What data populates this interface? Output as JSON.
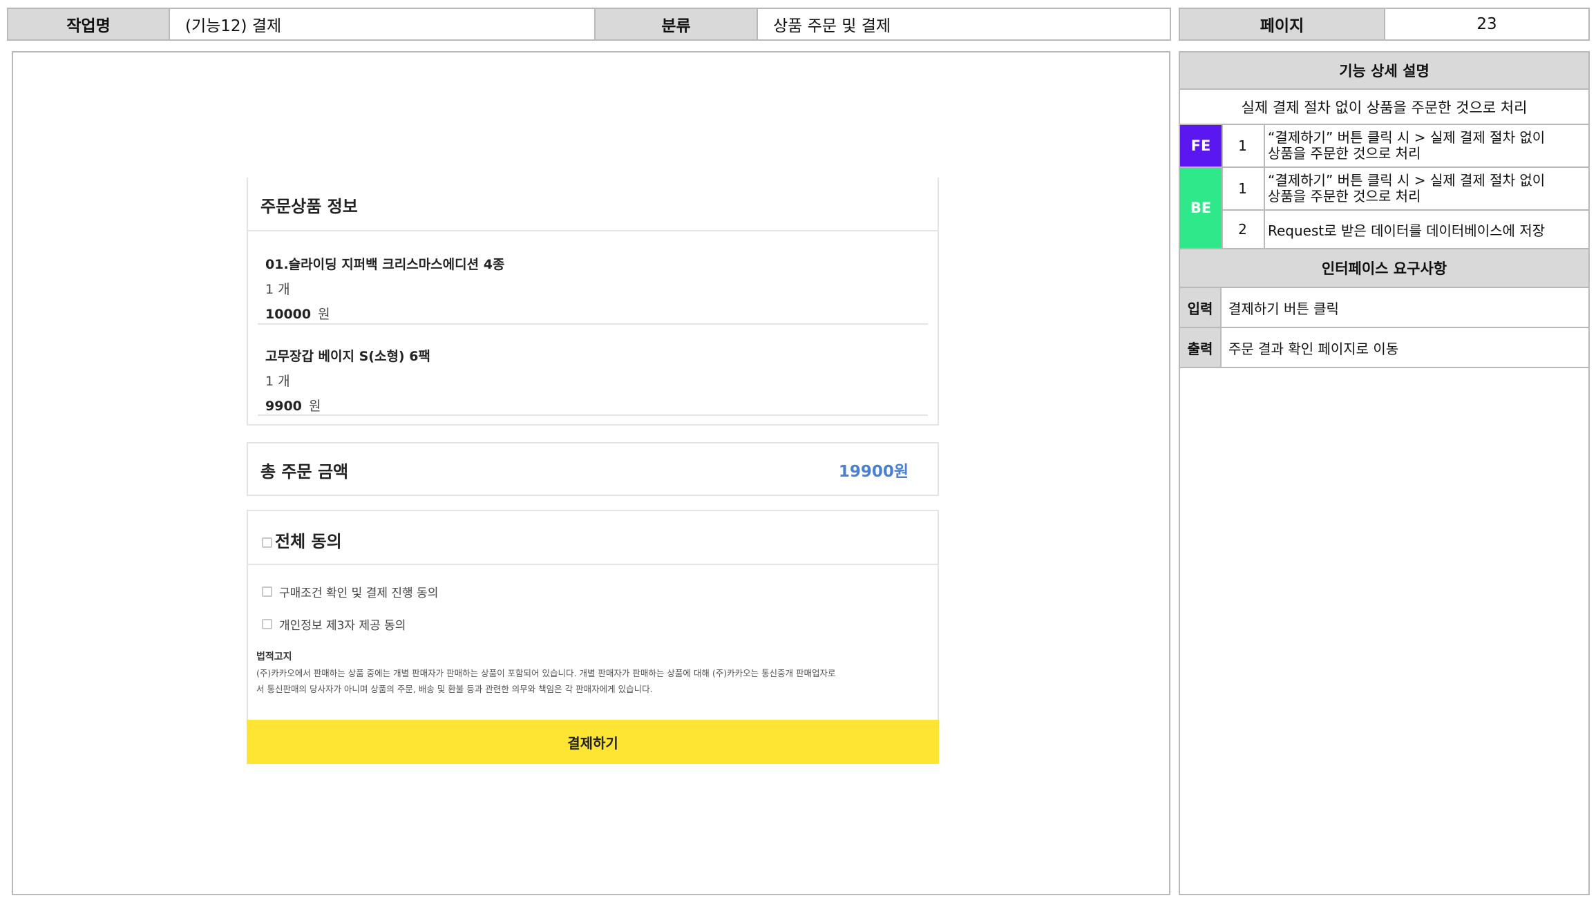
{
  "header": {
    "task_label": "작업명",
    "task_value": "(기능12) 결제",
    "category_label": "분류",
    "category_value": "상품 주문 및 결제",
    "page_label": "페이지",
    "page_value": "23"
  },
  "mockup": {
    "order_section_title": "주문상품 정보",
    "items": [
      {
        "name": "01.슬라이딩 지퍼백 크리스마스에디션 4종",
        "qty": "1 개",
        "price": "10000",
        "unit": "원"
      },
      {
        "name": "고무장갑 베이지 S(소형) 6팩",
        "qty": "1 개",
        "price": "9900",
        "unit": "원"
      }
    ],
    "total_label": "총 주문 금액",
    "total_value": "19900원",
    "agree_all_label": "전체 동의",
    "agree_items": [
      "구매조건 확인 및 결제 진행 동의",
      "개인정보 제3자 제공 동의"
    ],
    "legal_title": "법적고지",
    "legal_line1": "(주)카카오에서 판매하는 상품 중에는 개별 판매자가 판매하는 상품이 포함되어 있습니다. 개별 판매자가 판매하는 상품에 대해 (주)카카오는 통신중개 판매업자로",
    "legal_line2": "서 통신판매의 당사자가 아니며 상품의 주문, 배송 및 환불 등과 관련한 의무와 책임은 각 판매자에게 있습니다.",
    "pay_button": "결제하기"
  },
  "spec": {
    "title": "기능 상세 설명",
    "summary": "실제 결제 절차 없이 상품을 주문한 것으로 처리",
    "fe_label": "FE",
    "fe_rows": [
      {
        "no": "1",
        "line1": "“결제하기” 버튼 클릭 시 > 실제 결제 절차 없이",
        "line2": "상품을 주문한 것으로 처리"
      }
    ],
    "be_label": "BE",
    "be_rows": [
      {
        "no": "1",
        "line1": "“결제하기” 버튼 클릭 시 > 실제 결제 절차 없이",
        "line2": "상품을 주문한 것으로 처리"
      },
      {
        "no": "2",
        "line1": "Request로 받은 데이터를 데이터베이스에 저장",
        "line2": ""
      }
    ],
    "interface_title": "인터페이스 요구사항",
    "input_label": "입력",
    "input_value": "결제하기 버튼 클릭",
    "output_label": "출력",
    "output_value": "주문 결과 확인 페이지로 이동"
  },
  "colors": {
    "fe": "#5b17ef",
    "be": "#2ee88a",
    "pay_button": "#fee533",
    "total_value": "#4a7fd1",
    "header_bg": "#d9d9d9"
  }
}
